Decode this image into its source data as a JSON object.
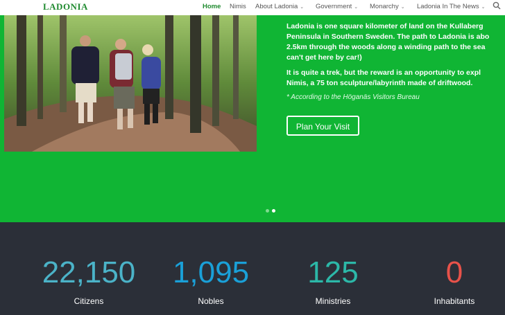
{
  "nav": {
    "logo": "LADONIA",
    "items": [
      {
        "label": "Home",
        "active": true,
        "has_submenu": false
      },
      {
        "label": "Nimis",
        "active": false,
        "has_submenu": false
      },
      {
        "label": "About Ladonia",
        "active": false,
        "has_submenu": true
      },
      {
        "label": "Government",
        "active": false,
        "has_submenu": true
      },
      {
        "label": "Monarchy",
        "active": false,
        "has_submenu": true
      },
      {
        "label": "Ladonia In The News",
        "active": false,
        "has_submenu": true
      }
    ],
    "search_icon": "search-icon"
  },
  "hero": {
    "background_color": "#10b534",
    "paragraph1_lines": [
      "Ladonia is one square kilometer of land on the Kullaberg",
      "Peninsula in Southern Sweden. The path to Ladonia is abo",
      "2.5km through the woods along a winding path to the sea",
      "can't get here by car!)"
    ],
    "paragraph2_lines": [
      "It is quite a trek, but the reward is an opportunity to expl",
      "Nimis, a 75 ton sculpture/labyrinth made of driftwood."
    ],
    "note": "* According to the Höganäs Visitors Bureau",
    "button_label": "Plan Your Visit",
    "slides_total": 2,
    "active_slide": 2
  },
  "stats": {
    "background_color": "#2b2f38",
    "items": [
      {
        "value": "22,150",
        "label": "Citizens",
        "color": "#4bb3c8"
      },
      {
        "value": "1,095",
        "label": "Nobles",
        "color": "#1aa0d8"
      },
      {
        "value": "125",
        "label": "Ministries",
        "color": "#2cb8a8"
      },
      {
        "value": "0",
        "label": "Inhabitants",
        "color": "#e8524a"
      }
    ]
  }
}
